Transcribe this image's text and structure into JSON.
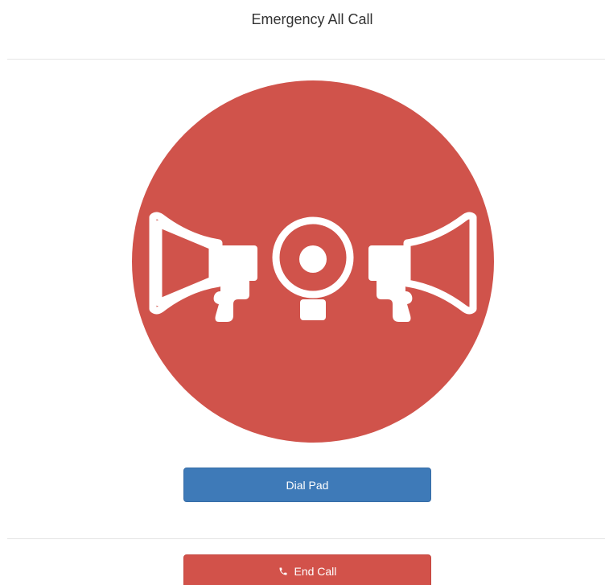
{
  "header": {
    "title": "Emergency All Call"
  },
  "emblem": {
    "icon": "megaphones-icon",
    "color": "#d0534b"
  },
  "actions": {
    "dial_pad_label": "Dial Pad",
    "end_call_label": "End Call",
    "end_call_icon": "phone-icon"
  },
  "colors": {
    "primary": "#3e7ab8",
    "danger": "#d2524a",
    "divider": "#e5e5e5"
  }
}
